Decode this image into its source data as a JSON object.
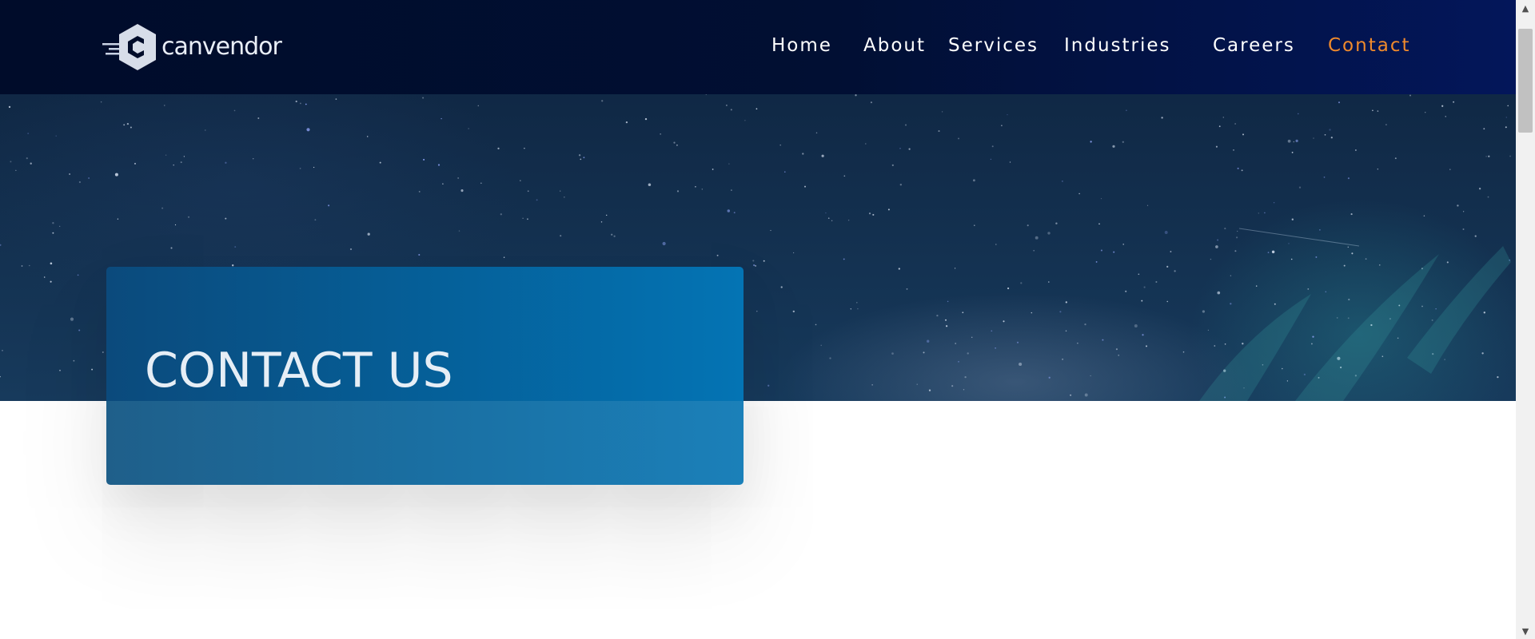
{
  "header": {
    "logo_text": "canvendor",
    "nav": [
      {
        "label": "Home",
        "active": false
      },
      {
        "label": "About",
        "active": false
      },
      {
        "label": "Services",
        "active": false
      },
      {
        "label": "Industries",
        "active": false
      },
      {
        "label": "Careers",
        "active": false
      },
      {
        "label": "Contact",
        "active": true
      }
    ]
  },
  "hero": {
    "title": "CONTACT US"
  },
  "colors": {
    "header_bg": "#000c2a",
    "nav_text": "#ffffff",
    "nav_active": "#f08a2c",
    "card_blue": "#055f98",
    "card_title": "#e6eef6"
  },
  "icons": {
    "logo": "canvendor-logo-icon",
    "scroll_up": "scroll-up-arrow-icon",
    "scroll_down": "scroll-down-arrow-icon"
  }
}
